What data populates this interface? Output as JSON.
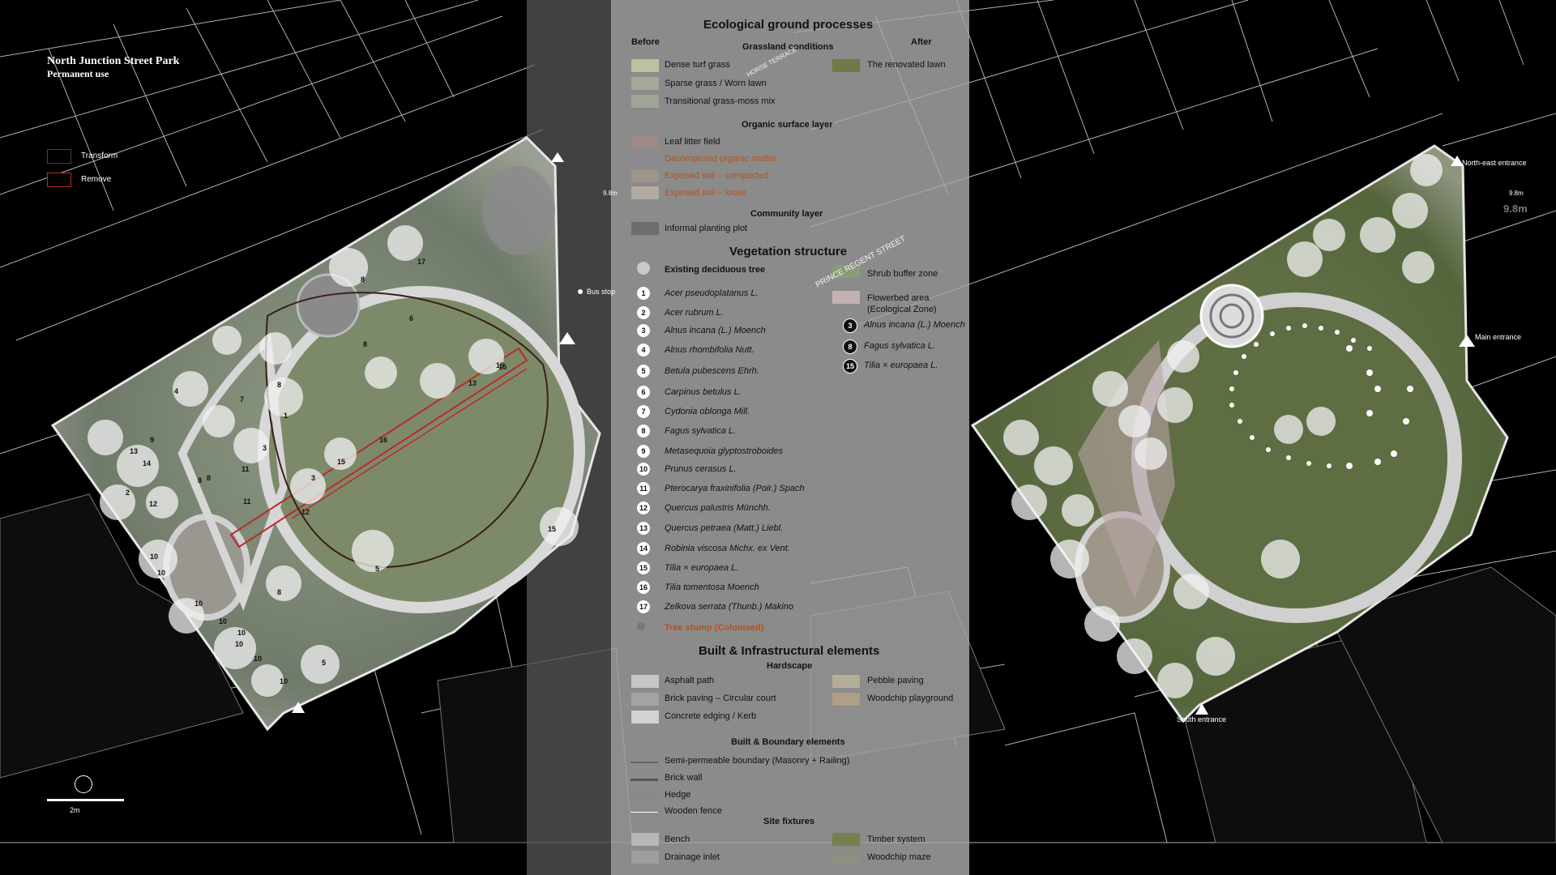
{
  "left_plan": {
    "title": "North Junction Street Park",
    "subtitle": "Permanent use",
    "legend": [
      {
        "label": "Transform"
      },
      {
        "label": "Remove"
      }
    ],
    "scale_label": "2m",
    "elev_label": "9.8m",
    "bus_stop": "Bus stop",
    "tree_labels_left": [
      "17",
      "8",
      "6",
      "4",
      "8",
      "7",
      "8",
      "1",
      "3",
      "8",
      "9",
      "13",
      "14",
      "2",
      "12",
      "11",
      "8",
      "3",
      "11",
      "15",
      "13",
      "15",
      "16",
      "15",
      "12",
      "10",
      "10",
      "10",
      "10",
      "5",
      "8",
      "5",
      "10",
      "10",
      "10",
      "10",
      "15"
    ]
  },
  "right_plan": {
    "labels": {
      "ne": "North-east entrance",
      "main": "Main entrance",
      "south": "South entrance"
    },
    "elev_label": "9.8m",
    "elev_label2": "9.8m"
  },
  "legend": {
    "header": "Ecological ground processes",
    "before": "Before",
    "after": "After",
    "grassland": {
      "title": "Grassland conditions",
      "items": [
        "Dense turf grass",
        "Sparse grass / Worn lawn",
        "Transitional grass-moss mix"
      ],
      "after_item": "The renovated lawn"
    },
    "organic": {
      "title": "Organic surface layer",
      "items": [
        "Leaf litter field",
        "Decomposed organic matter",
        "Exposed soil – compacted",
        "Exposed soil – loose"
      ]
    },
    "community": {
      "title": "Community layer",
      "items": [
        "Informal planting plot"
      ]
    },
    "vegetation": {
      "title": "Vegetation structure",
      "existing": "Existing deciduous tree",
      "shrub": "Shrub buffer zone",
      "flower": "Flowerbed area",
      "flower2": "(Ecological Zone)",
      "species": [
        {
          "n": "1",
          "name": "Acer pseudoplatanus L."
        },
        {
          "n": "2",
          "name": "Acer rubrum L."
        },
        {
          "n": "3",
          "name": "Alnus incana (L.) Moench"
        },
        {
          "n": "4",
          "name": "Alnus rhombifolia Nutt."
        },
        {
          "n": "5",
          "name": "Betula pubescens Ehrh."
        },
        {
          "n": "6",
          "name": "Carpinus betulus L."
        },
        {
          "n": "7",
          "name": "Cydonia oblonga Mill."
        },
        {
          "n": "8",
          "name": "Fagus sylvatica L."
        },
        {
          "n": "9",
          "name": "Metasequoia glyptostroboides"
        },
        {
          "n": "10",
          "name": "Prunus cerasus L."
        },
        {
          "n": "11",
          "name": "Pterocarya fraxinifolia (Poir.) Spach"
        },
        {
          "n": "12",
          "name": "Quercus palustris Münchh."
        },
        {
          "n": "13",
          "name": "Quercus petraea (Matt.) Liebl."
        },
        {
          "n": "14",
          "name": "Robinia viscosa Michx. ex Vent."
        },
        {
          "n": "15",
          "name": "Tilia × europaea L."
        },
        {
          "n": "16",
          "name": "Tilia tomentosa Moench"
        },
        {
          "n": "17",
          "name": "Zelkova serrata (Thunb.) Makino"
        }
      ],
      "new_species": [
        {
          "n": "3",
          "name": "Alnus incana (L.) Moench"
        },
        {
          "n": "8",
          "name": "Fagus sylvatica L."
        },
        {
          "n": "15",
          "name": "Tilia × europaea L."
        }
      ],
      "stump": "Tree stump (Colonised)"
    },
    "built": {
      "title": "Built & Infrastructural elements",
      "hardscape": "Hardscape",
      "hard_items": [
        "Asphalt path",
        "Brick paving – Circular court",
        "Concrete edging / Kerb"
      ],
      "hard_items_right": [
        "Pebble paving",
        "Woodchip playground"
      ],
      "boundary_title": "Built & Boundary elements",
      "boundary_items": [
        "Semi-permeable boundary (Masonry + Railing)",
        "Brick wall",
        "Hedge",
        "Wooden fence"
      ],
      "fixtures_title": "Site fixtures",
      "fixtures": [
        "Bench",
        "Drainage inlet"
      ],
      "fixtures_right": [
        "Timber system",
        "Woodchip maze"
      ]
    },
    "street1": "HORSE TERRACE",
    "street2": "PRINCE REGENT STREET"
  }
}
